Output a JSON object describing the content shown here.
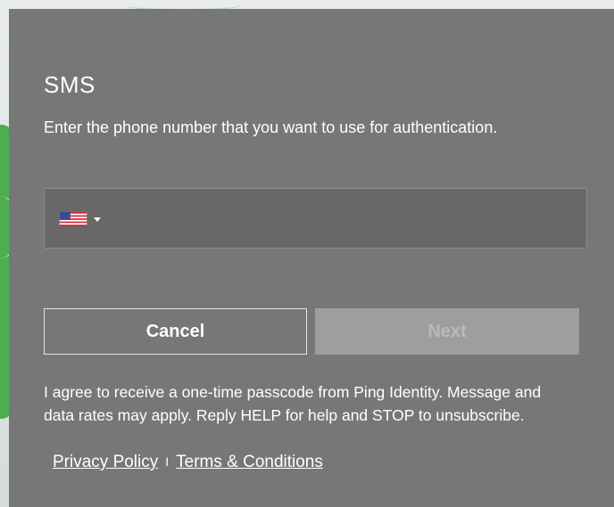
{
  "modal": {
    "title": "SMS",
    "description": "Enter the phone number that you want to use for authentication."
  },
  "phone_field": {
    "country_flag_icon": "us-flag-icon",
    "dropdown_icon": "caret-down-icon",
    "value": "",
    "placeholder": ""
  },
  "buttons": {
    "cancel_label": "Cancel",
    "next_label": "Next"
  },
  "consent": {
    "text": "I agree to receive a one-time passcode from Ping Identity. Message and data rates may apply. Reply HELP for help and STOP to unsubscribe.",
    "privacy_label": "Privacy Policy",
    "separator": "I",
    "terms_label": "Terms & Conditions"
  },
  "colors": {
    "modal_background": "#777776",
    "input_background": "#686868",
    "next_disabled_background": "#9e9e9e",
    "text": "#ffffff"
  }
}
